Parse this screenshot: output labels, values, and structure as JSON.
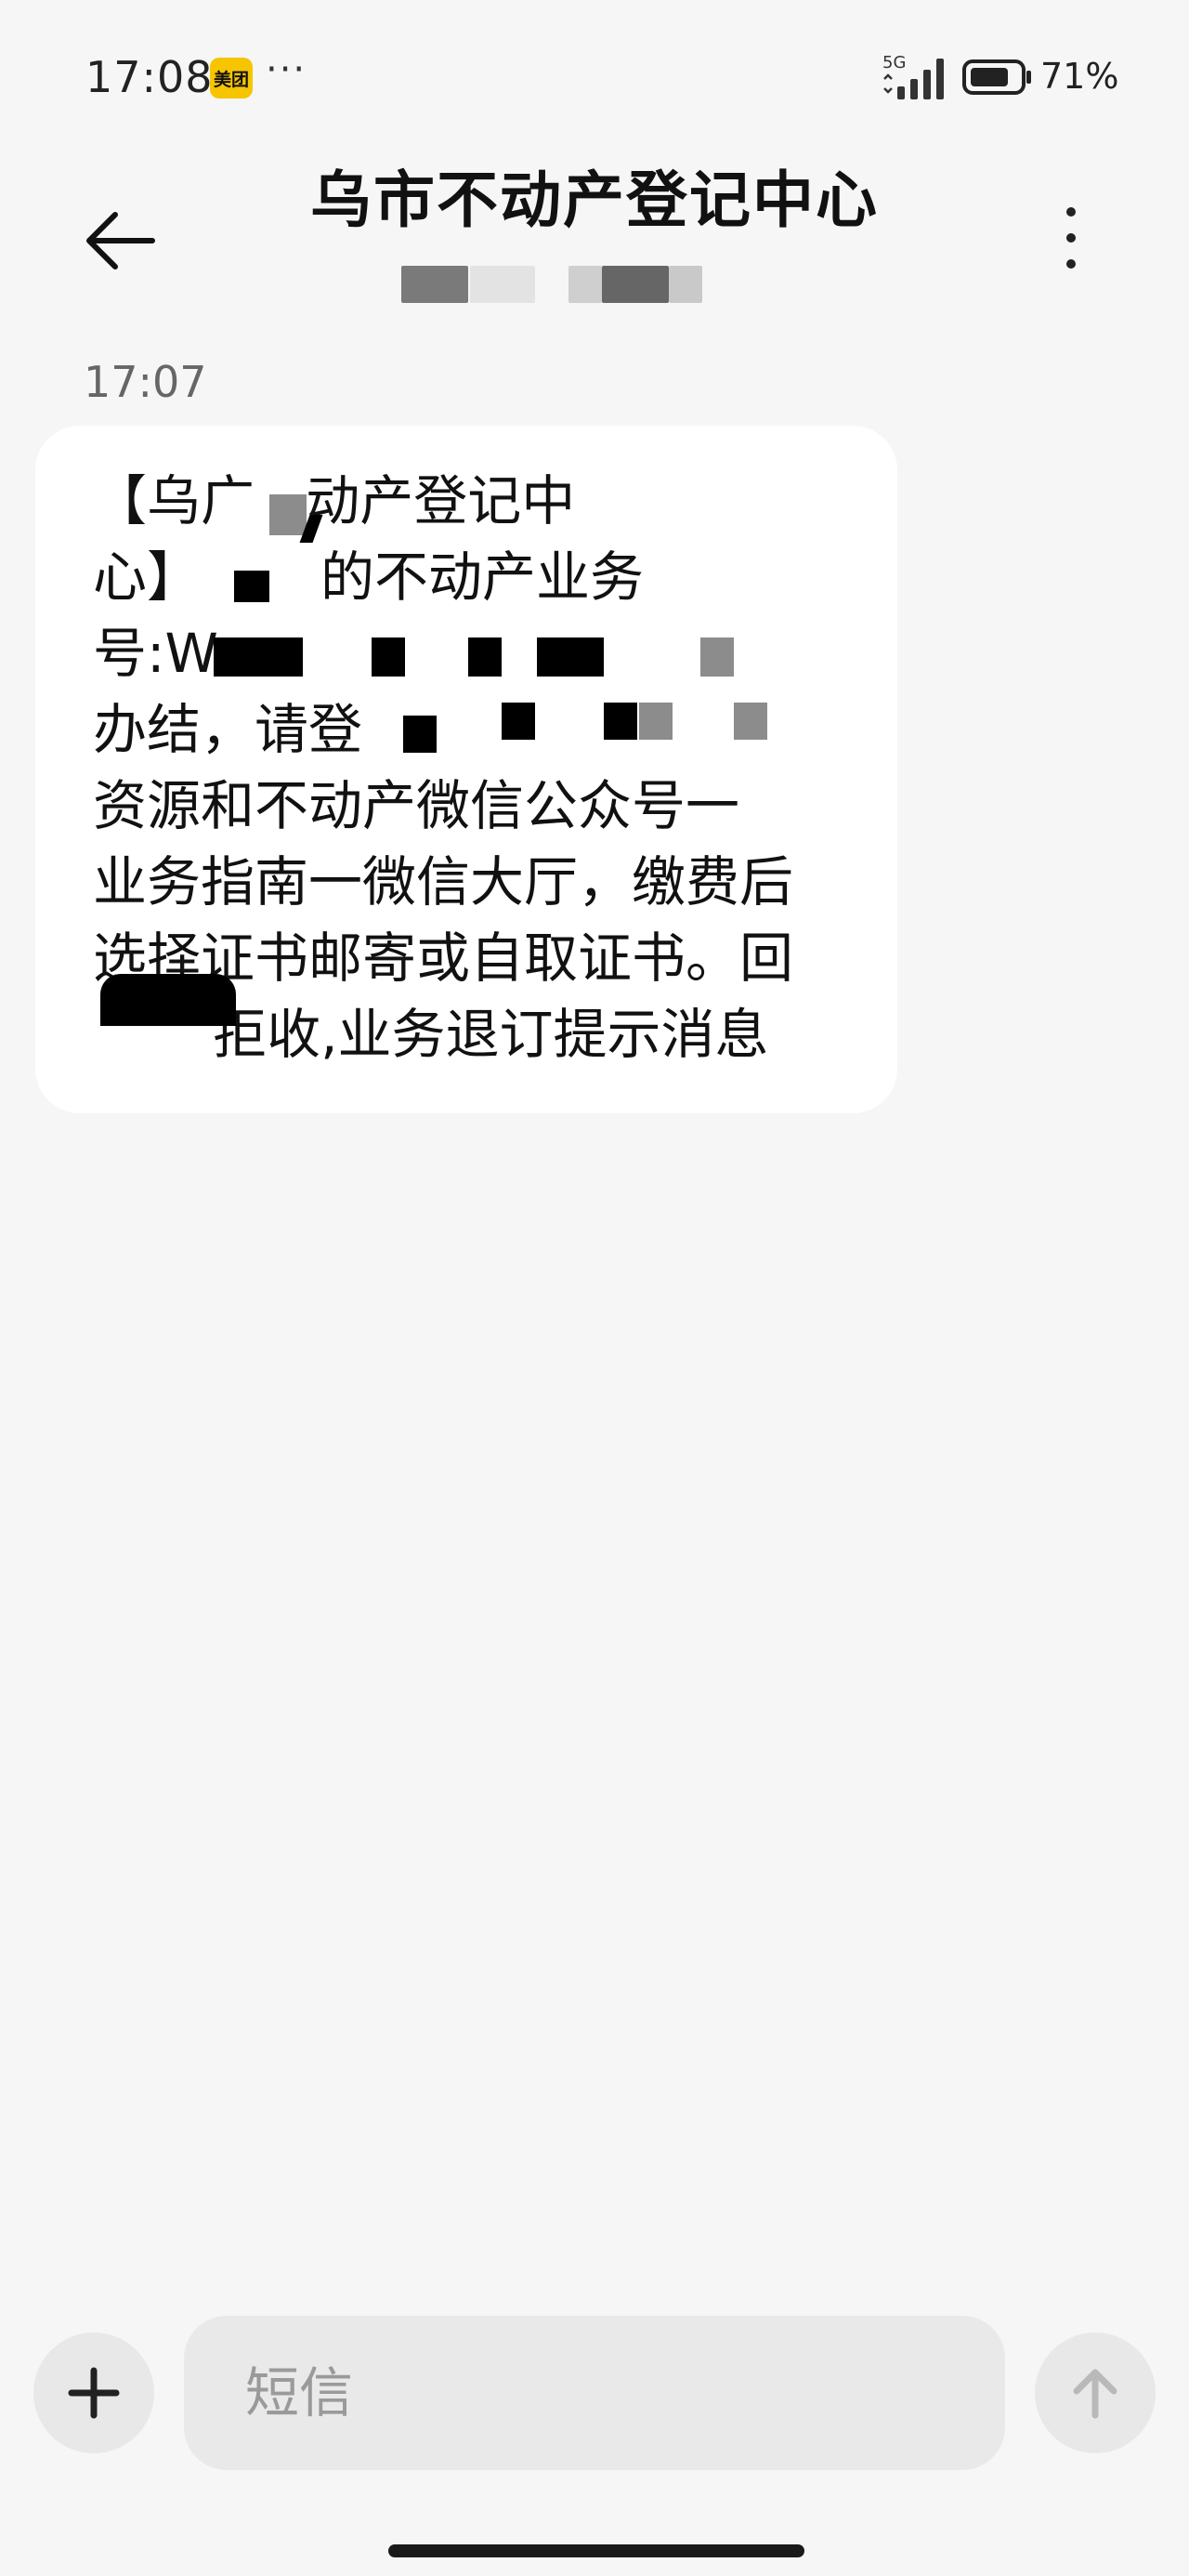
{
  "status_bar": {
    "time": "17:08",
    "app_badge": "美团",
    "more": "···",
    "network": "5G",
    "battery": "71%"
  },
  "header": {
    "title": "乌市不动产登记中心",
    "back_icon": "arrow-left-icon",
    "menu_icon": "more-vertical-icon"
  },
  "conversation": {
    "timestamp": "17:07",
    "message_lines": [
      "【乌广   动产登记中",
      "心】       的不动产业务",
      "号:W",
      "办结，请登",
      "资源和不动产微信公众号一",
      "业务指南一微信大厅，缴费后",
      "选择证书邮寄或自取证书。回",
      "       拒收,业务退订提示消息"
    ]
  },
  "composer": {
    "placeholder": "短信",
    "add_icon": "plus-icon",
    "send_icon": "arrow-up-icon"
  },
  "colors": {
    "background": "#f6f6f6",
    "bubble": "#ffffff",
    "badge": "#f6c500",
    "redaction": "#000000"
  }
}
